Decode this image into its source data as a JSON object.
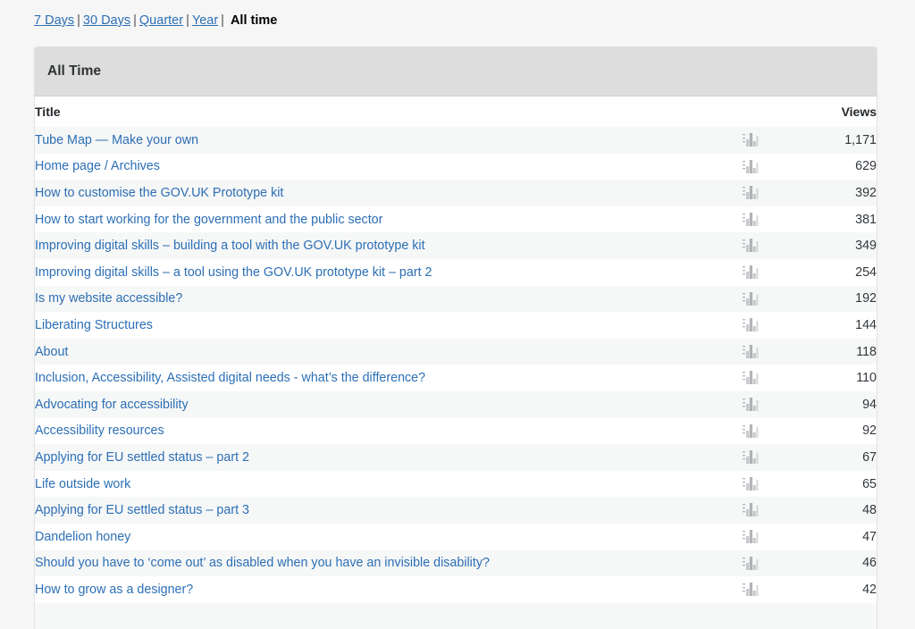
{
  "period_nav": {
    "separator": "|",
    "links": [
      {
        "label": "7 Days"
      },
      {
        "label": "30 Days"
      },
      {
        "label": "Quarter"
      },
      {
        "label": "Year"
      }
    ],
    "current": "All time"
  },
  "panel": {
    "title": "All Time"
  },
  "table": {
    "columns": {
      "title": "Title",
      "icon": "",
      "views": "Views"
    },
    "icon_name": "bar-chart-icon",
    "rows": [
      {
        "title": "Tube Map — Make your own",
        "views": "1,171"
      },
      {
        "title": "Home page / Archives",
        "views": "629"
      },
      {
        "title": "How to customise the GOV.UK Prototype kit",
        "views": "392"
      },
      {
        "title": "How to start working for the government and the public sector",
        "views": "381"
      },
      {
        "title": "Improving digital skills – building a tool with the GOV.UK prototype kit",
        "views": "349"
      },
      {
        "title": "Improving digital skills – a tool using the GOV.UK prototype kit – part 2",
        "views": "254"
      },
      {
        "title": "Is my website accessible?",
        "views": "192"
      },
      {
        "title": "Liberating Structures",
        "views": "144"
      },
      {
        "title": "About",
        "views": "118"
      },
      {
        "title": "Inclusion, Accessibility, Assisted digital needs - what’s the difference?",
        "views": "110"
      },
      {
        "title": "Advocating for accessibility",
        "views": "94"
      },
      {
        "title": "Accessibility resources",
        "views": "92"
      },
      {
        "title": "Applying for EU settled status – part 2",
        "views": "67"
      },
      {
        "title": "Life outside work",
        "views": "65"
      },
      {
        "title": "Applying for EU settled status – part 3",
        "views": "48"
      },
      {
        "title": "Dandelion honey",
        "views": "47"
      },
      {
        "title": "Should you have to ‘come out’ as disabled when you have an invisible disability?",
        "views": "46"
      },
      {
        "title": "How to grow as a designer?",
        "views": "42"
      },
      {
        "title": "",
        "views": ""
      }
    ]
  },
  "colors": {
    "link": "#2c6fb5",
    "panel_header_bg": "#dddddd",
    "row_stripe": "#f6f7f7",
    "page_bg": "#f6f6f6",
    "text": "#32373c"
  }
}
